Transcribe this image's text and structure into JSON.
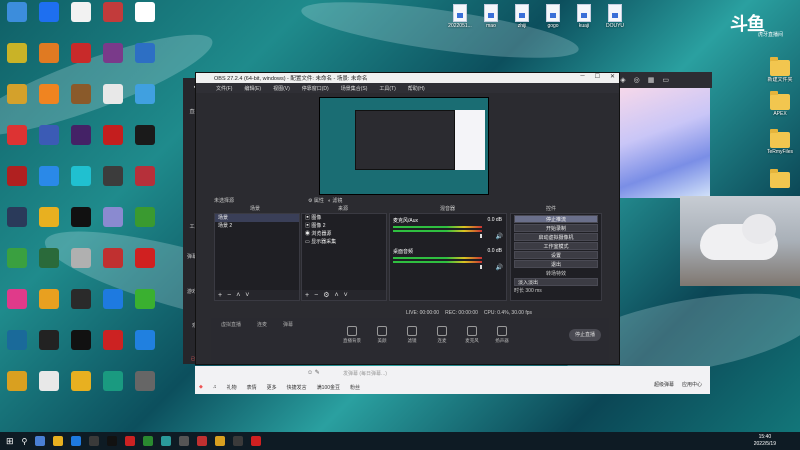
{
  "desktop": {
    "left_icons": [
      {
        "label": "",
        "color": "#3c8ddc"
      },
      {
        "label": "",
        "color": "#1e6ff0"
      },
      {
        "label": "",
        "color": "#f2f2f2"
      },
      {
        "label": "",
        "color": "#c23b3b"
      },
      {
        "label": "",
        "color": "#ffffff"
      },
      {
        "label": "",
        "color": "#c9b327"
      },
      {
        "label": "",
        "color": "#e07a22"
      },
      {
        "label": "",
        "color": "#c82a2a"
      },
      {
        "label": "",
        "color": "#7a3a8a"
      },
      {
        "label": "",
        "color": "#2d6fc4"
      },
      {
        "label": "",
        "color": "#d4a12b"
      },
      {
        "label": "",
        "color": "#f08420"
      },
      {
        "label": "",
        "color": "#8a5a2a"
      },
      {
        "label": "",
        "color": "#e8e8e8"
      },
      {
        "label": "",
        "color": "#40a0e0"
      },
      {
        "label": "",
        "color": "#d33"
      },
      {
        "label": "",
        "color": "#3b5bb5"
      },
      {
        "label": "",
        "color": "#442266"
      },
      {
        "label": "",
        "color": "#c41e1e"
      },
      {
        "label": "",
        "color": "#1a1a1a"
      },
      {
        "label": "",
        "color": "#b02020"
      },
      {
        "label": "",
        "color": "#2a89e8"
      },
      {
        "label": "",
        "color": "#20c0d0"
      },
      {
        "label": "",
        "color": "#3c3c3c"
      },
      {
        "label": "",
        "color": "#b6303a"
      },
      {
        "label": "",
        "color": "#2a3a5a"
      },
      {
        "label": "",
        "color": "#e8b020"
      },
      {
        "label": "",
        "color": "#111111"
      },
      {
        "label": "",
        "color": "#8a8ad0"
      },
      {
        "label": "",
        "color": "#3a9a30"
      },
      {
        "label": "",
        "color": "#3aa040"
      },
      {
        "label": "",
        "color": "#2a6a3a"
      },
      {
        "label": "",
        "color": "#b0b0b0"
      },
      {
        "label": "",
        "color": "#c03030"
      },
      {
        "label": "",
        "color": "#d02020"
      },
      {
        "label": "",
        "color": "#e03a8a"
      },
      {
        "label": "",
        "color": "#e8a020"
      },
      {
        "label": "",
        "color": "#2a2a2a"
      },
      {
        "label": "",
        "color": "#1e7ae0"
      },
      {
        "label": "",
        "color": "#3ab030"
      },
      {
        "label": "",
        "color": "#1a6a9a"
      },
      {
        "label": "",
        "color": "#222222"
      },
      {
        "label": "",
        "color": "#111111"
      },
      {
        "label": "",
        "color": "#cc2222"
      },
      {
        "label": "",
        "color": "#2080e0"
      },
      {
        "label": "",
        "color": "#d9a020"
      },
      {
        "label": "",
        "color": "#e8e8e8"
      },
      {
        "label": "",
        "color": "#e8b020"
      },
      {
        "label": "",
        "color": "#1a9a80"
      },
      {
        "label": "",
        "color": "#666666"
      }
    ],
    "top_files": [
      "2022051...",
      "mao",
      "zhiji",
      "gogo",
      "kuaji",
      "DOUYU"
    ],
    "right_folders": [
      "",
      "新建文件夹",
      "APEX",
      "TeRmyFiles",
      ""
    ]
  },
  "obs": {
    "title": "OBS 27.2.4 (64-bit, windows) - 配置文件: 未命名 - 场景: 未命名",
    "menu": [
      "文件(F)",
      "编辑(E)",
      "视图(V)",
      "停靠窗口(D)",
      "场景集合(S)",
      "工具(T)",
      "帮助(H)"
    ],
    "no_source_selected": "未选择源",
    "properties_label": "属性",
    "filters_label": "滤镜",
    "dock_titles": {
      "scenes": "场景",
      "sources": "来源",
      "mixer": "混音器",
      "transitions": "转场特效",
      "controls": "控件"
    },
    "scenes": [
      "场景",
      "场景 2"
    ],
    "sources": [
      "图像",
      "图像 2",
      "浏览器源",
      "显示器采集"
    ],
    "mixer": [
      {
        "name": "桌面音频",
        "db": "0.0 dB"
      },
      {
        "name": "麦克风/Aux",
        "db": "0.0 dB"
      }
    ],
    "controls": [
      "停止推流",
      "开始录制",
      "启动虚拟摄像机",
      "工作室模式",
      "设置",
      "退出"
    ],
    "transition": {
      "type": "淡入淡出",
      "duration_label": "时长",
      "duration": "300 ms"
    },
    "status": {
      "live": "LIVE: 00:00:00",
      "rec": "REC: 00:00:00",
      "cpu": "CPU: 0.4%, 30.00 fps"
    }
  },
  "douyu_app": {
    "left_nav": [
      "直播间",
      "工具箱",
      "弹幕助手",
      "游戏中心",
      "观看",
      "直播间设置"
    ],
    "bottom_tabs": [
      "虚拟直播",
      "连麦",
      "弹幕"
    ],
    "bottom_tools": [
      "直播背景",
      "美颜",
      "滤镜",
      "连麦",
      "麦克风",
      "扬声器"
    ],
    "start_live": "停止直播",
    "fav_notice": "已收藏插件点此查看"
  },
  "chatbar": {
    "placeholder": "发弹幕 (每日弹幕...)",
    "tools": [
      "礼物",
      "表情",
      "更多",
      "快捷发言"
    ],
    "coupon": "满100金豆",
    "fans": "粉丝",
    "msg": "超级弹幕",
    "app": "应用中心"
  },
  "taskbar": {
    "time": "15:40",
    "date": "2022/5/19"
  },
  "logo": {
    "text": "斗鱼",
    "sub": "虎牙直播间"
  }
}
